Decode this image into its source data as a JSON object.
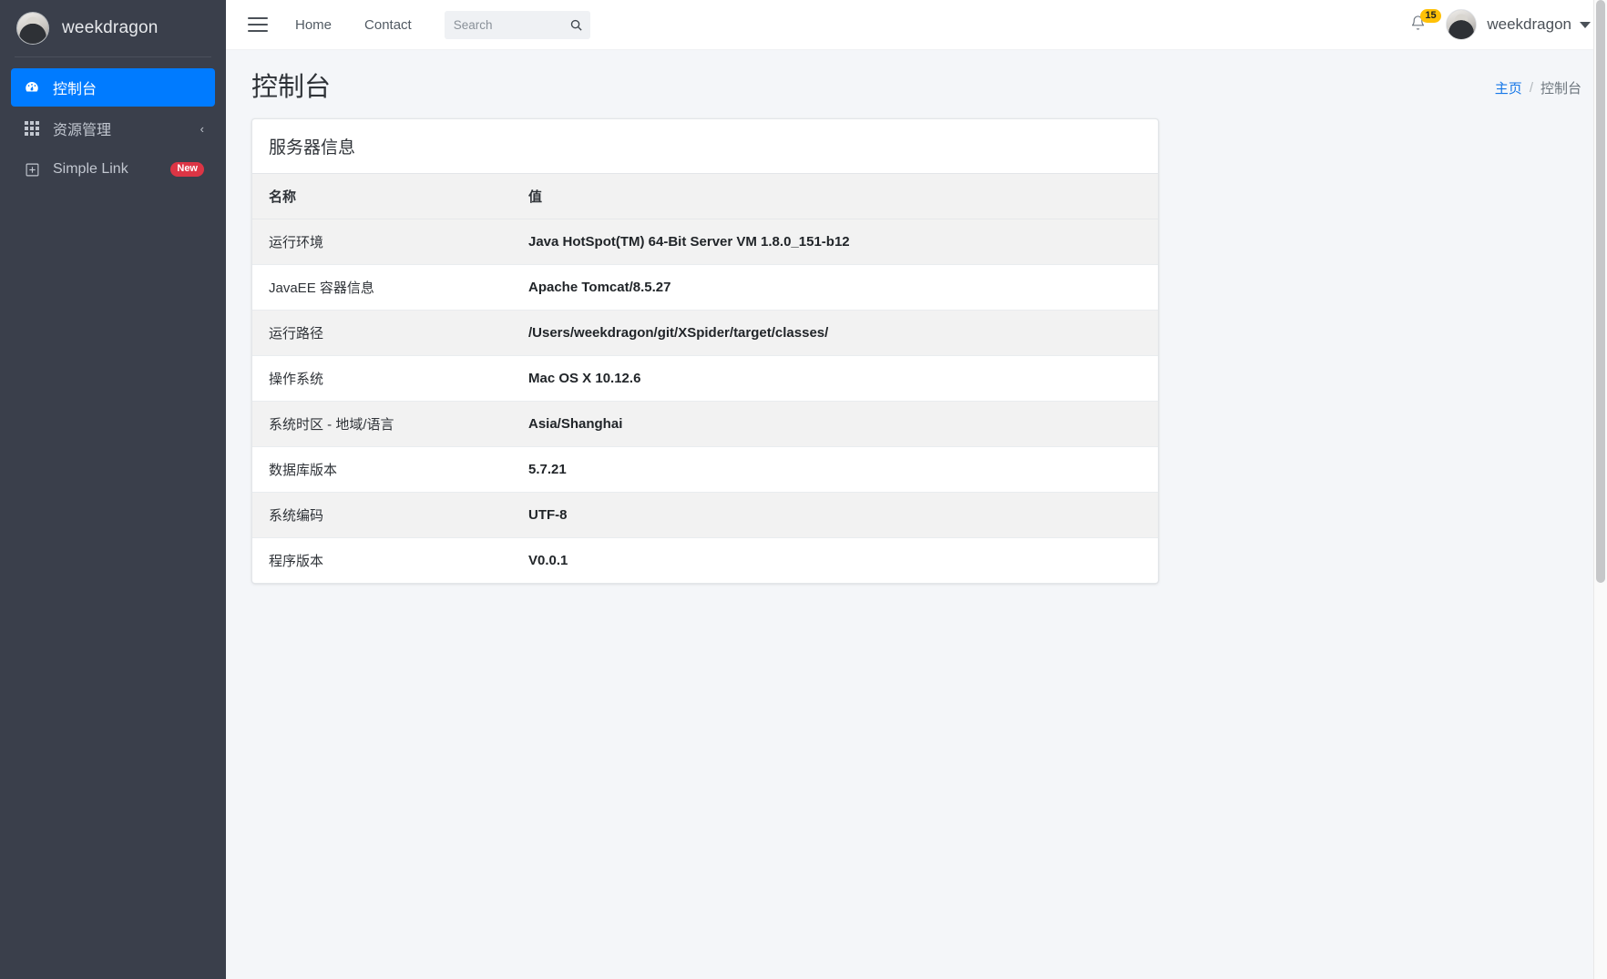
{
  "sidebar": {
    "brand": {
      "name": "weekdragon",
      "avatar_icon": "user-avatar-photo"
    },
    "items": [
      {
        "label": "控制台",
        "icon": "dashboard-speedometer-icon",
        "active": true
      },
      {
        "label": "资源管理",
        "icon": "grid-apps-icon",
        "chevron": "‹",
        "active": false
      },
      {
        "label": "Simple Link",
        "icon": "plus-square-icon",
        "badge": "New",
        "active": false
      }
    ]
  },
  "topbar": {
    "menu_toggle_icon": "hamburger-icon",
    "links": [
      {
        "label": "Home"
      },
      {
        "label": "Contact"
      }
    ],
    "search": {
      "value": "",
      "placeholder": "Search",
      "icon": "search-icon"
    },
    "notifications": {
      "icon": "bell-icon",
      "count": "15"
    },
    "user": {
      "name": "weekdragon",
      "icon": "user-avatar-photo",
      "caret": "chevron-down-icon"
    }
  },
  "content": {
    "page_title": "控制台",
    "breadcrumb": {
      "home": "主页",
      "separator": "/",
      "current": "控制台"
    },
    "card": {
      "title": "服务器信息",
      "columns": [
        "名称",
        "值"
      ],
      "rows": [
        {
          "name": "运行环境",
          "value": "Java HotSpot(TM) 64-Bit Server VM 1.8.0_151-b12"
        },
        {
          "name": "JavaEE 容器信息",
          "value": "Apache Tomcat/8.5.27"
        },
        {
          "name": "运行路径",
          "value": "/Users/weekdragon/git/XSpider/target/classes/"
        },
        {
          "name": "操作系统",
          "value": "Mac OS X 10.12.6"
        },
        {
          "name": "系统时区 - 地域/语言",
          "value": "Asia/Shanghai"
        },
        {
          "name": "数据库版本",
          "value": "5.7.21"
        },
        {
          "name": "系统编码",
          "value": "UTF-8"
        },
        {
          "name": "程序版本",
          "value": "V0.0.1"
        }
      ]
    }
  },
  "colors": {
    "sidebar_bg": "#3a3f4b",
    "active_blue": "#007bff",
    "badge_new_red": "#dc3545",
    "badge_count_yellow": "#ffc107",
    "main_bg": "#f4f6f9",
    "link_blue": "#1677e8"
  }
}
